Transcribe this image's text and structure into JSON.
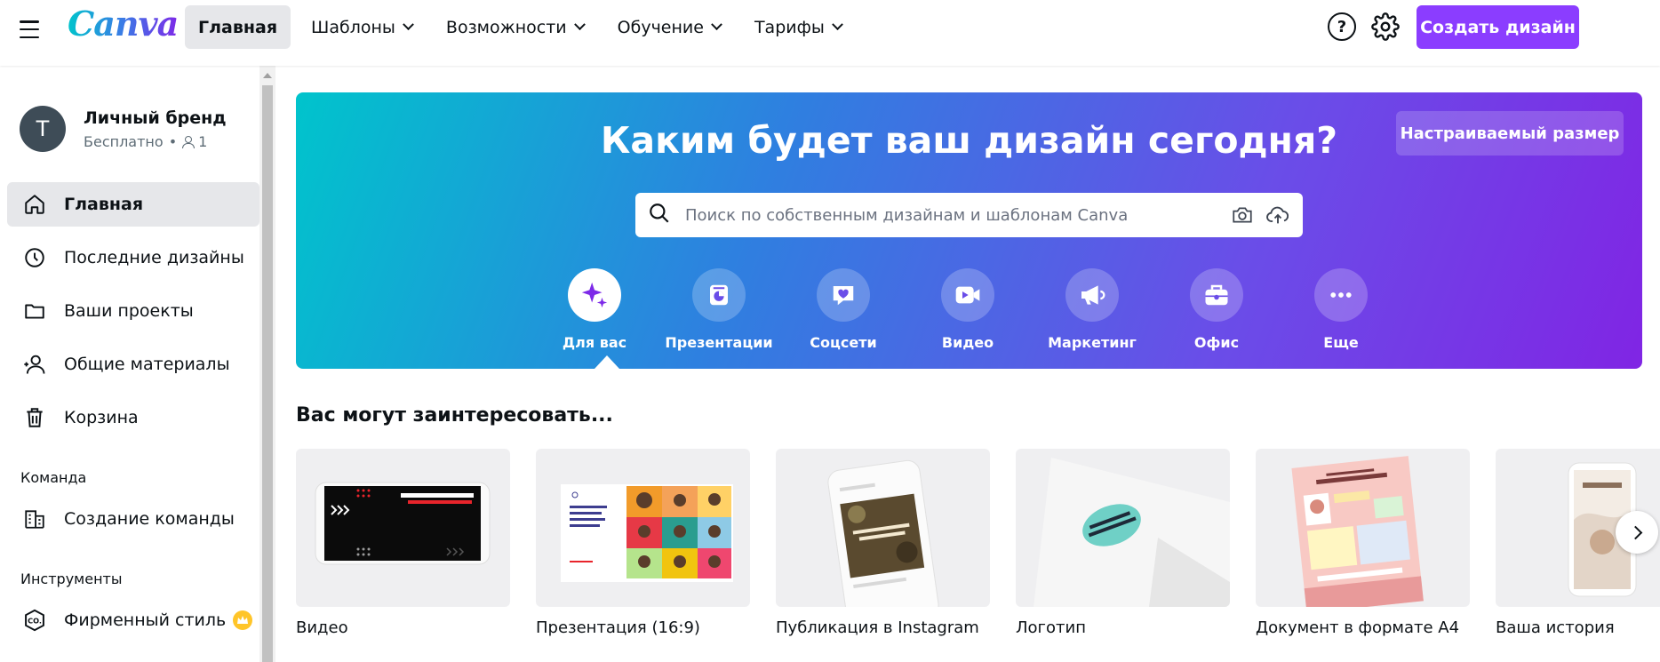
{
  "header": {
    "logo": "Canva",
    "nav": [
      {
        "label": "Главная",
        "active": true,
        "dropdown": false
      },
      {
        "label": "Шаблоны",
        "active": false,
        "dropdown": true
      },
      {
        "label": "Возможности",
        "active": false,
        "dropdown": true
      },
      {
        "label": "Обучение",
        "active": false,
        "dropdown": true
      },
      {
        "label": "Тарифы",
        "active": false,
        "dropdown": true
      }
    ],
    "help_symbol": "?",
    "create_label": "Создать дизайн"
  },
  "sidebar": {
    "profile": {
      "initial": "T",
      "name": "Личный бренд",
      "plan": "Бесплатно",
      "members": "1"
    },
    "items": [
      {
        "label": "Главная",
        "icon": "home-icon",
        "active": true
      },
      {
        "label": "Последние дизайны",
        "icon": "clock-icon",
        "active": false
      },
      {
        "label": "Ваши проекты",
        "icon": "folder-icon",
        "active": false
      },
      {
        "label": "Общие материалы",
        "icon": "people-icon",
        "active": false
      },
      {
        "label": "Корзина",
        "icon": "trash-icon",
        "active": false
      }
    ],
    "team_section": "Команда",
    "team_item": {
      "label": "Создание команды",
      "icon": "building-icon"
    },
    "tools_section": "Инструменты",
    "tools_item": {
      "label": "Фирменный стиль",
      "icon": "brand-kit-icon",
      "badge": "crown-icon"
    }
  },
  "hero": {
    "title": "Каким будет ваш дизайн сегодня?",
    "custom_size": "Настраиваемый размер",
    "search_placeholder": "Поиск по собственным дизайнам и шаблонам Canva",
    "categories": [
      {
        "label": "Для вас",
        "icon": "sparkle-icon",
        "active": true
      },
      {
        "label": "Презентации",
        "icon": "presentation-icon",
        "active": false
      },
      {
        "label": "Соцсети",
        "icon": "heart-chat-icon",
        "active": false
      },
      {
        "label": "Видео",
        "icon": "video-icon",
        "active": false
      },
      {
        "label": "Маркетинг",
        "icon": "megaphone-icon",
        "active": false
      },
      {
        "label": "Офис",
        "icon": "briefcase-icon",
        "active": false
      },
      {
        "label": "Еще",
        "icon": "more-icon",
        "active": false
      }
    ]
  },
  "suggestions": {
    "title": "Вас могут заинтересовать...",
    "items": [
      {
        "label": "Видео"
      },
      {
        "label": "Презентация (16:9)"
      },
      {
        "label": "Публикация в Instagram"
      },
      {
        "label": "Логотип"
      },
      {
        "label": "Документ в формате A4"
      },
      {
        "label": "Ваша история"
      }
    ]
  },
  "colors": {
    "accent": "#8b3dff",
    "hero_gradient": [
      "#00c4cc",
      "#2f7fe0",
      "#6a4de8",
      "#8025e4"
    ],
    "avatar": "#3e4c57",
    "crown": "#ffc529"
  }
}
